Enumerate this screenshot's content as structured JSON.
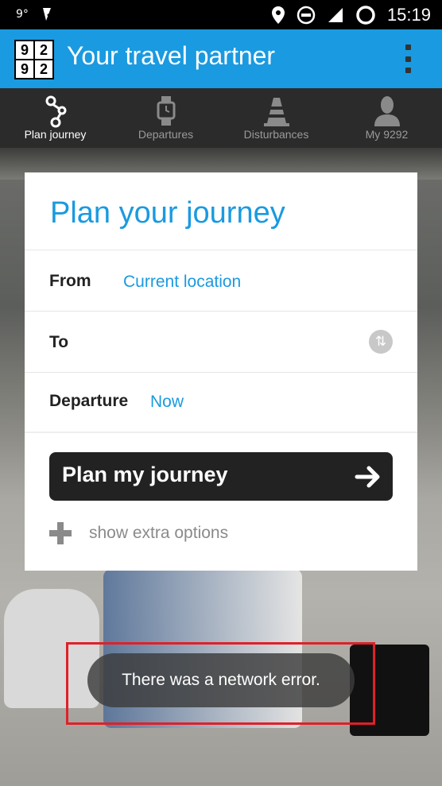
{
  "status_bar": {
    "temperature": "9°",
    "time": "15:19"
  },
  "app_bar": {
    "logo_digits": [
      "9",
      "2",
      "9",
      "2"
    ],
    "title": "Your travel partner"
  },
  "tabs": [
    {
      "label": "Plan journey",
      "icon": "journey-icon",
      "active": true
    },
    {
      "label": "Departures",
      "icon": "watch-icon",
      "active": false
    },
    {
      "label": "Disturbances",
      "icon": "cone-icon",
      "active": false
    },
    {
      "label": "My 9292",
      "icon": "person-icon",
      "active": false
    }
  ],
  "card": {
    "heading": "Plan your journey",
    "from_label": "From",
    "from_value": "Current location",
    "to_label": "To",
    "departure_label": "Departure",
    "departure_value": "Now",
    "plan_button": "Plan my journey",
    "extra_options": "show extra options"
  },
  "toast": {
    "message": "There was a network error."
  },
  "colors": {
    "accent": "#1a9ae0",
    "tab_bar": "#2b2b2b",
    "button": "#222222",
    "highlight": "#e0202a"
  }
}
